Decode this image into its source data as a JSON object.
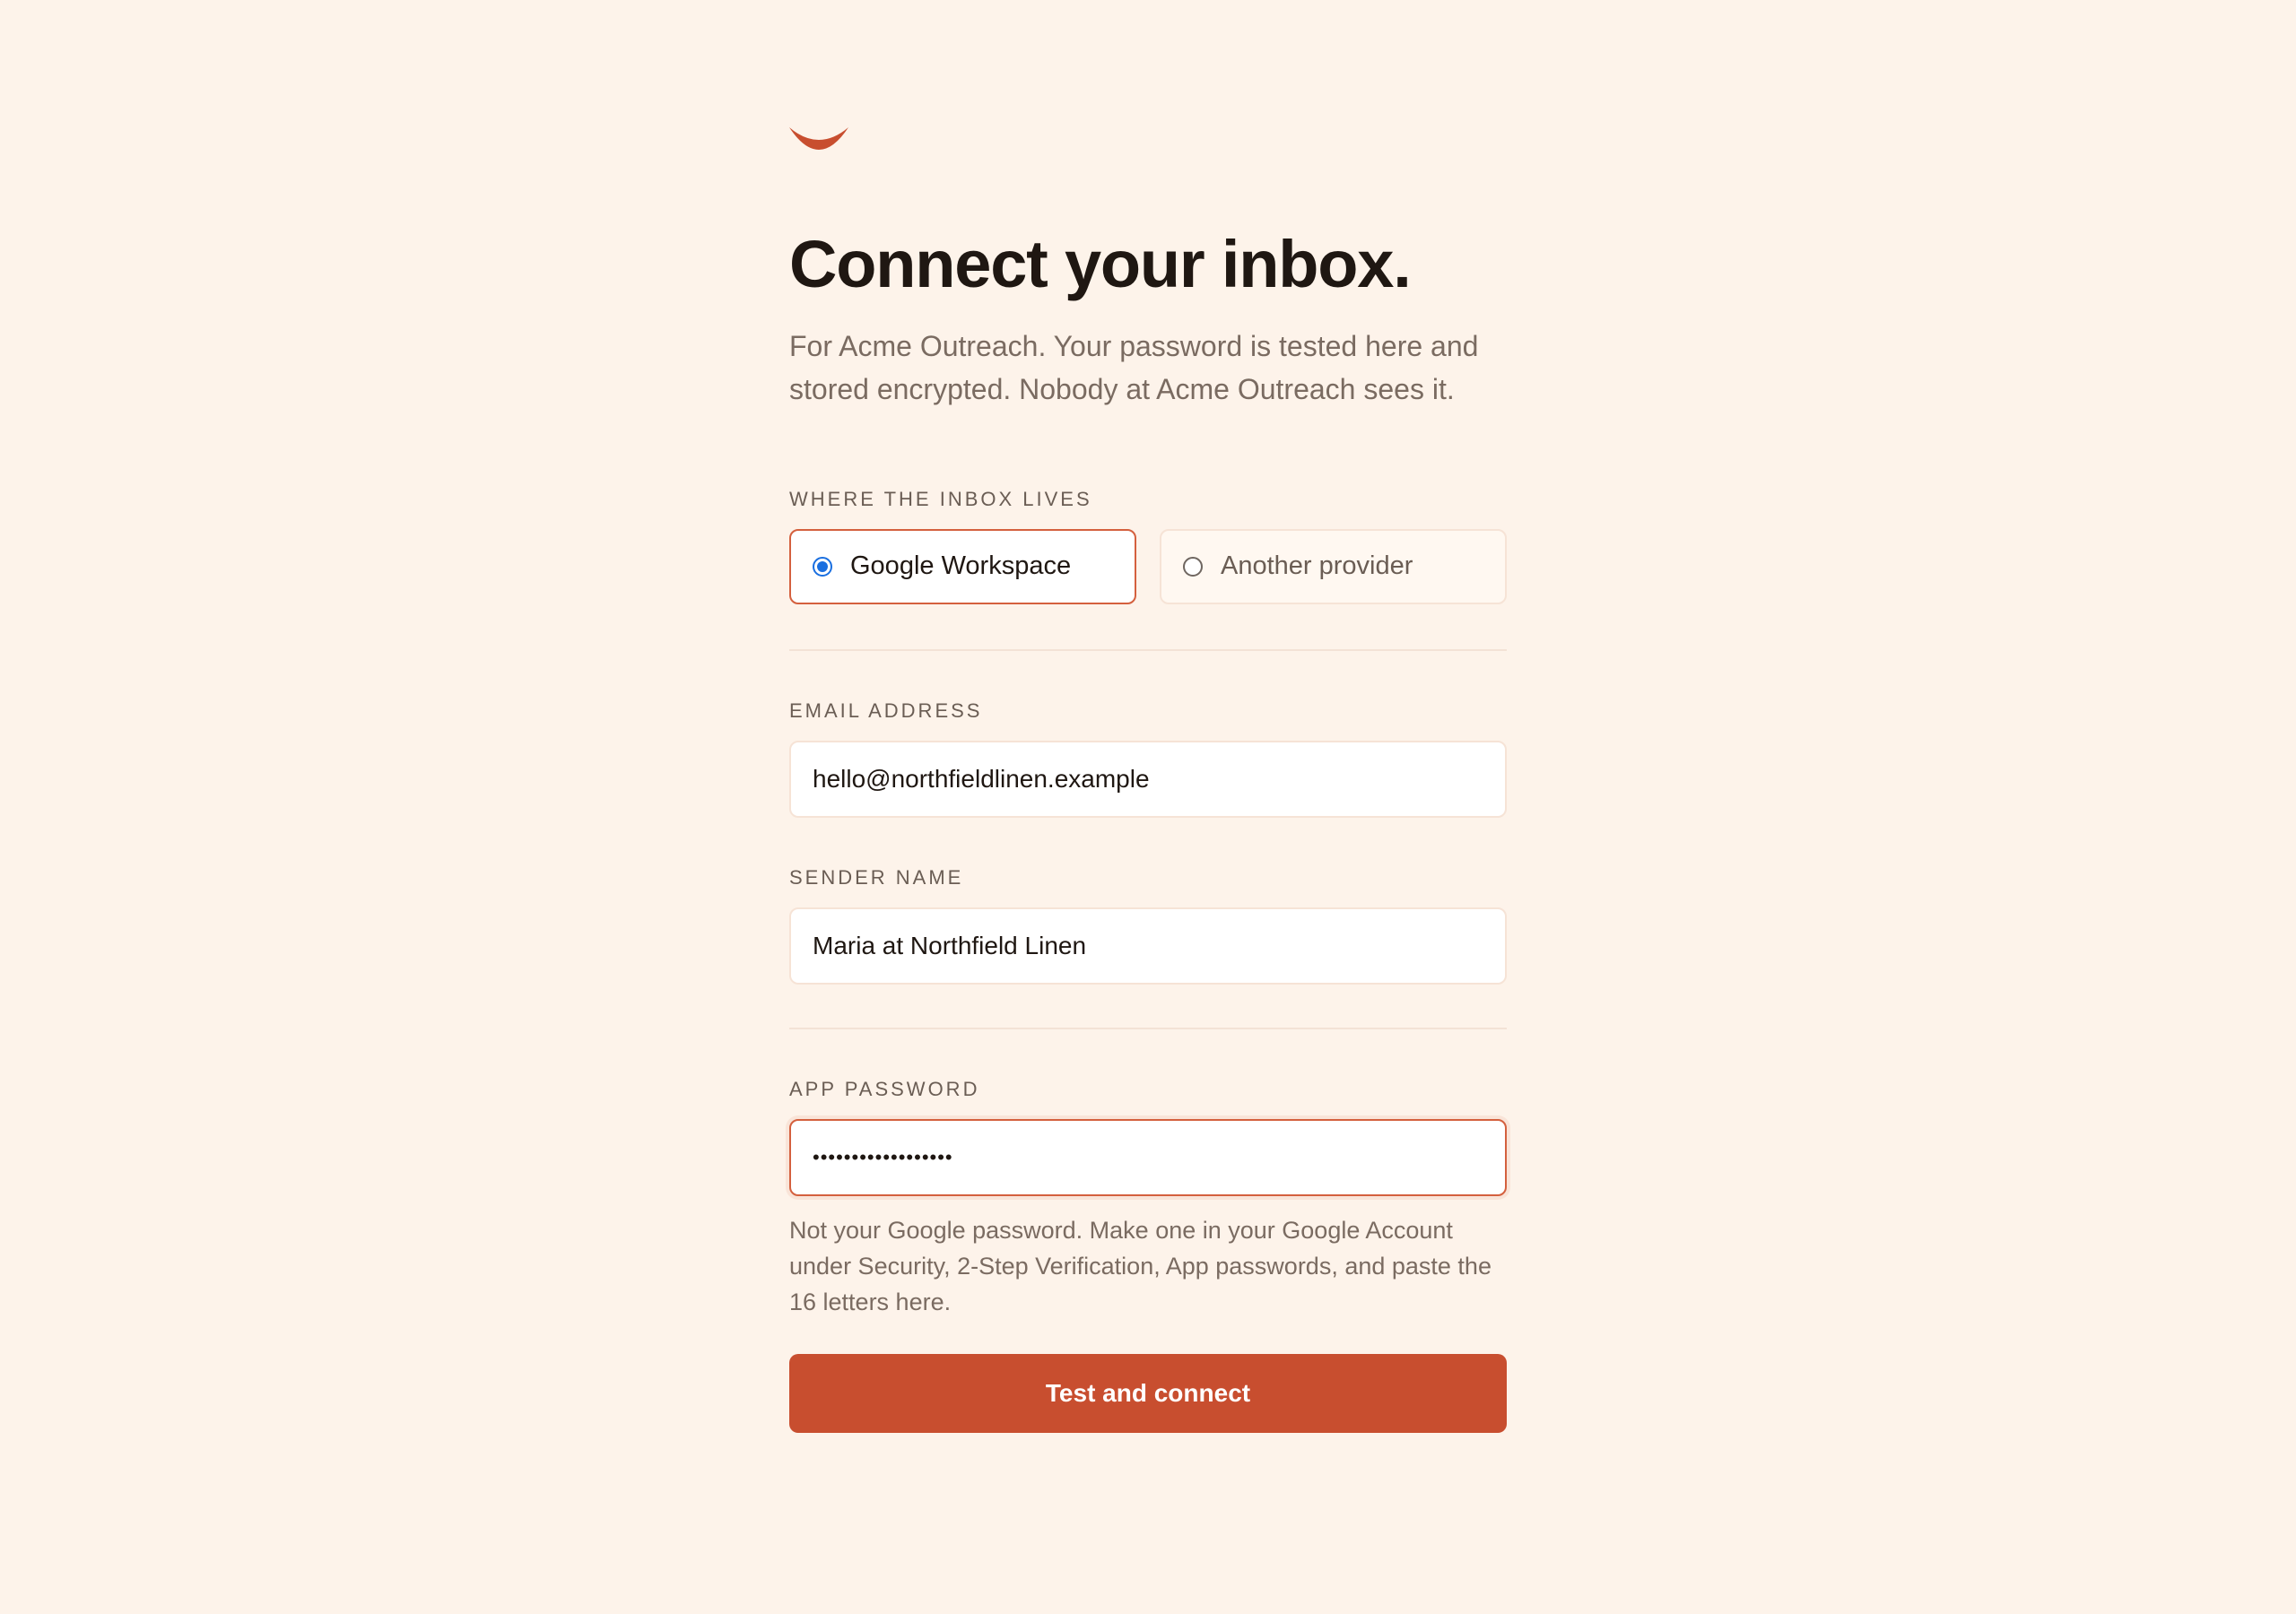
{
  "brand": {
    "logo_icon": "chevron-mark-icon",
    "accent_color": "#c84e2f"
  },
  "header": {
    "title": "Connect your inbox.",
    "subtitle": "For Acme Outreach. Your password is tested here and stored encrypted. Nobody at Acme Outreach sees it."
  },
  "provider": {
    "label": "WHERE THE INBOX LIVES",
    "options": [
      {
        "label": "Google Workspace",
        "selected": true
      },
      {
        "label": "Another provider",
        "selected": false
      }
    ]
  },
  "email": {
    "label": "EMAIL ADDRESS",
    "value": "hello@northfieldlinen.example"
  },
  "sender": {
    "label": "SENDER NAME",
    "value": "Maria at Northfield Linen"
  },
  "app_password": {
    "label": "APP PASSWORD",
    "masked_value": "••••••••••••••••••",
    "help": "Not your Google password. Make one in your Google Account under Security, 2-Step Verification, App passwords, and paste the 16 letters here."
  },
  "submit": {
    "label": "Test and connect"
  }
}
